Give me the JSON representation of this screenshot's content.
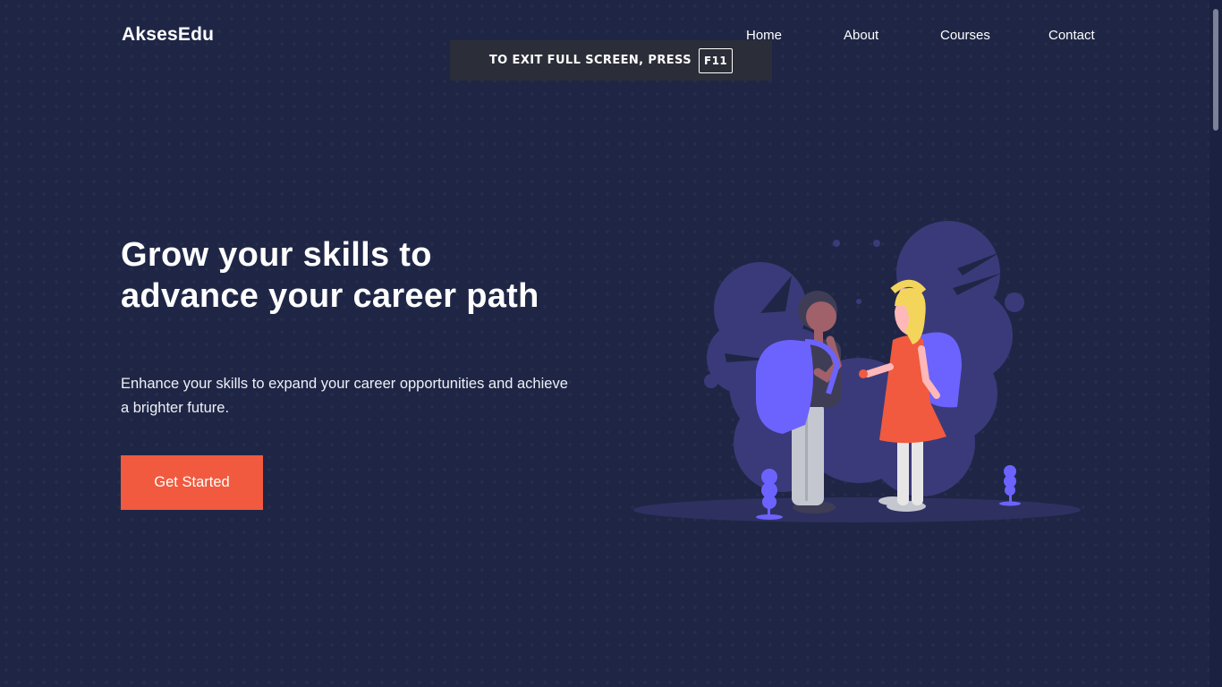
{
  "header": {
    "logo": "AksesEdu",
    "nav": [
      "Home",
      "About",
      "Courses",
      "Contact"
    ]
  },
  "fullscreen_notice": {
    "text": "TO EXIT FULL SCREEN, PRESS",
    "key": "F11"
  },
  "hero": {
    "title": "Grow your skills to advance your career path",
    "subtitle": "Enhance your skills to expand your career opportunities and achieve a brighter future.",
    "cta_label": "Get Started"
  },
  "colors": {
    "background": "#1f2645",
    "accent": "#f15a3e",
    "illustration_purple": "#6c63ff"
  },
  "icons": {
    "illustration": "students-with-backpacks-illustration"
  }
}
